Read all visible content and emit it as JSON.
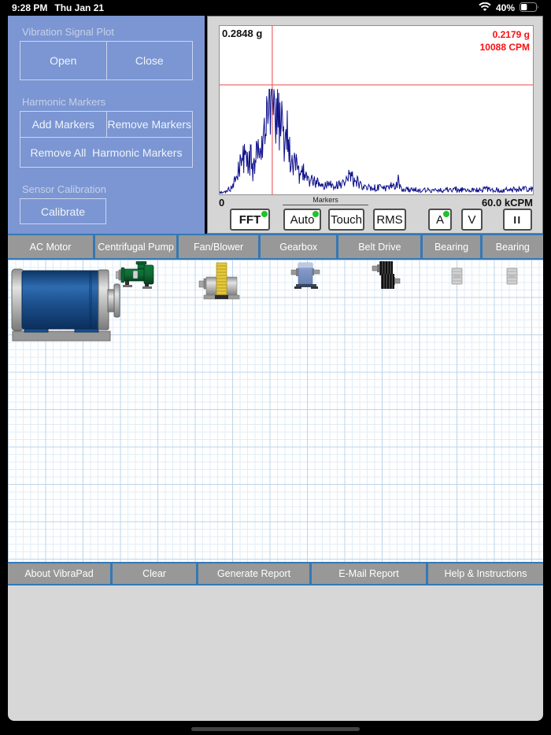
{
  "status_bar": {
    "time": "9:28 PM",
    "date": "Thu Jan 21",
    "battery": "40%"
  },
  "left_panel": {
    "vibration_section": {
      "label": "Vibration Signal Plot",
      "open": "Open",
      "close": "Close"
    },
    "harmonic_section": {
      "label": "Harmonic Markers",
      "add": "Add Markers",
      "remove": "Remove Markers",
      "remove_all": "Remove All  Harmonic Markers"
    },
    "calibration_section": {
      "label": "Sensor Calibration",
      "calibrate": "Calibrate"
    }
  },
  "plot": {
    "y_max_label": "0.2848 g",
    "cursor_amplitude": "0.2179 g",
    "cursor_frequency": "10088 CPM",
    "x_min_label": "0",
    "x_max_label": "60.0 kCPM",
    "markers_group_label": "Markers",
    "buttons": {
      "fft": "FFT",
      "auto": "Auto",
      "touch": "Touch",
      "rms": "RMS",
      "accel": "A",
      "vel": "V",
      "pause": "II"
    },
    "crosshair": {
      "x_fraction": 0.168,
      "y_fraction_from_top": 0.35
    }
  },
  "chart_data": {
    "type": "line",
    "title": "FFT vibration spectrum",
    "x_range_cpm": [
      0,
      60000
    ],
    "x_axis_labels": [
      "0",
      "60.0 kCPM"
    ],
    "y_full_scale_g": 0.2848,
    "cursor": {
      "amplitude_g": 0.2179,
      "frequency_cpm": 10088
    },
    "legend": "none",
    "grid": false,
    "envelope_points": [
      [
        0,
        0.005
      ],
      [
        0.02,
        0.01
      ],
      [
        0.04,
        0.04
      ],
      [
        0.055,
        0.1
      ],
      [
        0.07,
        0.19
      ],
      [
        0.08,
        0.22
      ],
      [
        0.09,
        0.16
      ],
      [
        0.1,
        0.21
      ],
      [
        0.105,
        0.14
      ],
      [
        0.115,
        0.16
      ],
      [
        0.12,
        0.3
      ],
      [
        0.125,
        0.18
      ],
      [
        0.13,
        0.22
      ],
      [
        0.135,
        0.3
      ],
      [
        0.14,
        0.32
      ],
      [
        0.15,
        0.44
      ],
      [
        0.155,
        0.48
      ],
      [
        0.16,
        0.52
      ],
      [
        0.165,
        0.56
      ],
      [
        0.168,
        0.59
      ],
      [
        0.172,
        0.52
      ],
      [
        0.178,
        0.46
      ],
      [
        0.185,
        0.5
      ],
      [
        0.19,
        0.4
      ],
      [
        0.2,
        0.36
      ],
      [
        0.205,
        0.3
      ],
      [
        0.21,
        0.26
      ],
      [
        0.215,
        0.32
      ],
      [
        0.22,
        0.25
      ],
      [
        0.23,
        0.19
      ],
      [
        0.24,
        0.16
      ],
      [
        0.25,
        0.12
      ],
      [
        0.26,
        0.1
      ],
      [
        0.27,
        0.13
      ],
      [
        0.28,
        0.08
      ],
      [
        0.3,
        0.07
      ],
      [
        0.32,
        0.06
      ],
      [
        0.34,
        0.05
      ],
      [
        0.36,
        0.05
      ],
      [
        0.38,
        0.05
      ],
      [
        0.4,
        0.06
      ],
      [
        0.41,
        0.09
      ],
      [
        0.42,
        0.12
      ],
      [
        0.43,
        0.06
      ],
      [
        0.44,
        0.08
      ],
      [
        0.45,
        0.05
      ],
      [
        0.47,
        0.04
      ],
      [
        0.5,
        0.035
      ],
      [
        0.53,
        0.03
      ],
      [
        0.55,
        0.05
      ],
      [
        0.56,
        0.03
      ],
      [
        0.57,
        0.08
      ],
      [
        0.58,
        0.03
      ],
      [
        0.6,
        0.025
      ],
      [
        0.65,
        0.02
      ],
      [
        0.7,
        0.02
      ],
      [
        0.75,
        0.025
      ],
      [
        0.8,
        0.02
      ],
      [
        0.85,
        0.025
      ],
      [
        0.9,
        0.02
      ],
      [
        0.95,
        0.025
      ],
      [
        1,
        0.03
      ]
    ]
  },
  "tabs": [
    "AC Motor",
    "Centrifugal Pump",
    "Fan/Blower",
    "Gearbox",
    "Belt Drive",
    "Bearing",
    "Bearing"
  ],
  "canvas": {
    "equipment_icons": [
      "ac-motor-icon",
      "centrifugal-pump-icon",
      "fan-blower-icon",
      "gearbox-icon",
      "belt-drive-icon",
      "bearing-icon",
      "bearing-icon"
    ]
  },
  "toolbar": {
    "about": "About VibraPad",
    "clear": "Clear",
    "generate": "Generate Report",
    "email": "E-Mail Report",
    "help": "Help & Instructions"
  },
  "colors": {
    "panel_blue": "#7b96d2",
    "bar_blue": "#3578b5",
    "tab_gray": "#989898",
    "record_green": "#1fc32d",
    "cursor_red": "#ef6f6f",
    "readout_red": "#fb0f0f",
    "spectrum_navy": "#10128c"
  }
}
